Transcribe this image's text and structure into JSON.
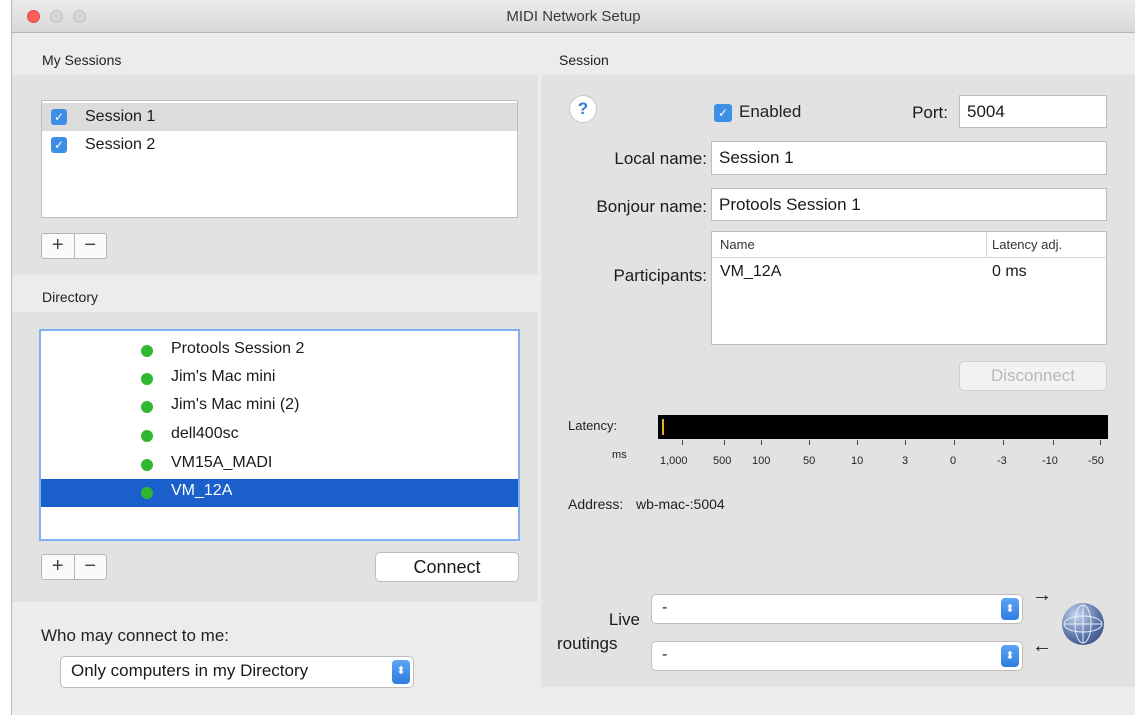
{
  "window": {
    "title": "MIDI Network Setup"
  },
  "my_sessions": {
    "heading": "My Sessions",
    "items": [
      {
        "label": "Session 1",
        "checked": true
      },
      {
        "label": "Session 2",
        "checked": true
      }
    ],
    "add": "+",
    "remove": "−"
  },
  "directory": {
    "heading": "Directory",
    "items": [
      {
        "label": "Protools Session 2"
      },
      {
        "label": "Jim's Mac mini"
      },
      {
        "label": "Jim's Mac mini (2)"
      },
      {
        "label": "dell400sc"
      },
      {
        "label": "VM15A_MADI"
      },
      {
        "label": "VM_12A",
        "selected": true
      }
    ],
    "add": "+",
    "remove": "−",
    "connect_label": "Connect"
  },
  "who_may_connect": {
    "label": "Who may connect to me:",
    "value": "Only computers in my Directory"
  },
  "session": {
    "heading": "Session",
    "help": "?",
    "enabled_label": "Enabled",
    "port_label": "Port:",
    "port_value": "5004",
    "local_name_label": "Local name:",
    "local_name_value": "Session 1",
    "bonjour_name_label": "Bonjour name:",
    "bonjour_name_value": "Protools Session 1",
    "participants_label": "Participants:",
    "participants_columns": [
      "Name",
      "Latency adj."
    ],
    "participants_rows": [
      {
        "name": "VM_12A",
        "latency": "0 ms"
      }
    ],
    "disconnect_label": "Disconnect",
    "latency_label": "Latency:",
    "latency_unit": "ms",
    "latency_ticks": [
      "1,000",
      "500",
      "100",
      "50",
      "10",
      "3",
      "0",
      "-3",
      "-10",
      "-50"
    ],
    "address_label": "Address:",
    "address_value": "wb-mac-:5004",
    "live_routings_label_1": "Live",
    "live_routings_label_2": "routings",
    "routing_out": "-",
    "routing_in": "-",
    "arrow_out": "→",
    "arrow_in": "←"
  },
  "colors": {
    "accent": "#3d8fe6",
    "selection": "#1a5fcc",
    "online": "#2eb82e"
  }
}
